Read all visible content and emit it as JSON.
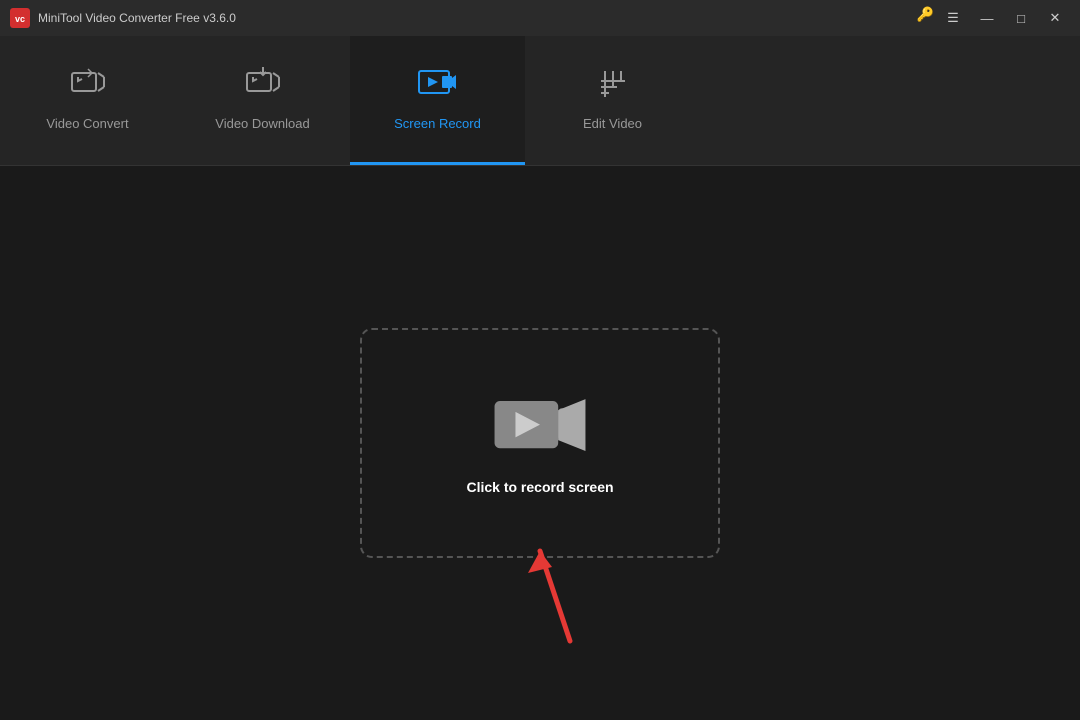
{
  "titleBar": {
    "appName": "MiniTool Video Converter Free v3.6.0",
    "logoText": "vc",
    "controls": {
      "minimize": "—",
      "maximize": "□",
      "close": "✕"
    }
  },
  "navTabs": [
    {
      "id": "video-convert",
      "label": "Video Convert",
      "active": false
    },
    {
      "id": "video-download",
      "label": "Video Download",
      "active": false
    },
    {
      "id": "screen-record",
      "label": "Screen Record",
      "active": true
    },
    {
      "id": "edit-video",
      "label": "Edit Video",
      "active": false
    }
  ],
  "mainArea": {
    "recordBox": {
      "label": "Click to record screen"
    }
  }
}
